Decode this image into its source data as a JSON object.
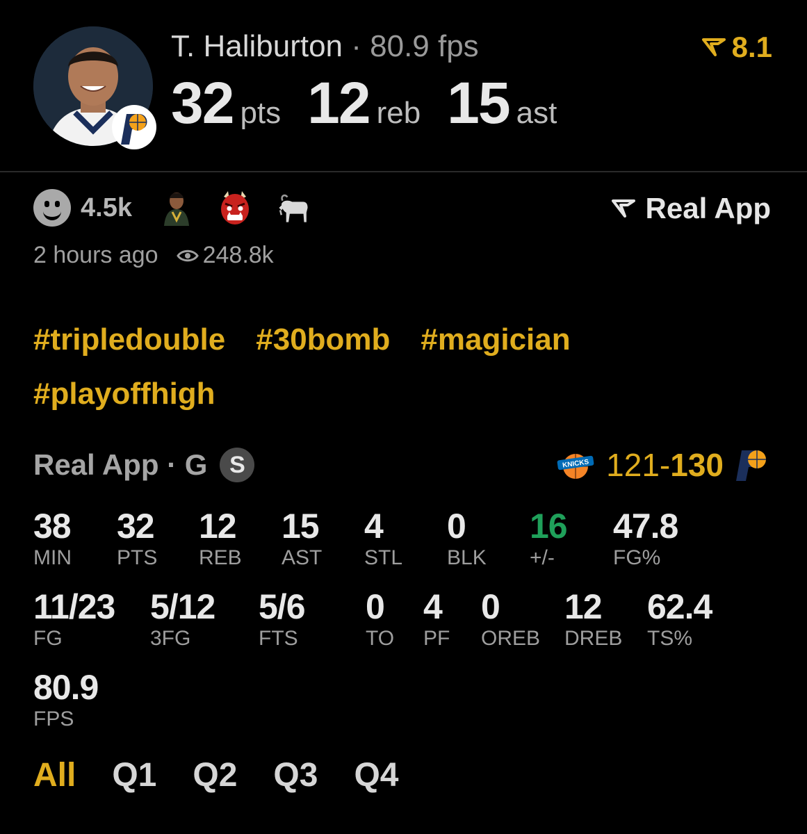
{
  "header": {
    "player_name": "T. Haliburton",
    "separator": " · ",
    "fps_text": "80.9 fps",
    "rating": "8.1",
    "big_stats": [
      {
        "value": "32",
        "unit": "pts"
      },
      {
        "value": "12",
        "unit": "reb"
      },
      {
        "value": "15",
        "unit": "ast"
      }
    ]
  },
  "reactions": {
    "count": "4.5k",
    "icons": [
      "smiley-icon",
      "player-emoji-icon",
      "oni-mask-icon",
      "goat-icon"
    ],
    "source_label": "Real App"
  },
  "meta": {
    "time": "2 hours ago",
    "views": "248.8k"
  },
  "hashtags": [
    "#tripledouble",
    "#30bomb",
    "#magician",
    "#playoffhigh"
  ],
  "box": {
    "source": "Real App",
    "position": "G",
    "badge": "S",
    "score_away": "121",
    "score_dash": "-",
    "score_home": "130",
    "away_team_icon": "knicks-logo",
    "home_team_icon": "pacers-logo",
    "row1": [
      {
        "value": "38",
        "label": "MIN"
      },
      {
        "value": "32",
        "label": "PTS"
      },
      {
        "value": "12",
        "label": "REB"
      },
      {
        "value": "15",
        "label": "AST"
      },
      {
        "value": "4",
        "label": "STL"
      },
      {
        "value": "0",
        "label": "BLK"
      },
      {
        "value": "16",
        "label": "+/-"
      },
      {
        "value": "47.8",
        "label": "FG%"
      }
    ],
    "row2": [
      {
        "value": "11/23",
        "label": "FG"
      },
      {
        "value": "5/12",
        "label": "3FG"
      },
      {
        "value": "5/6",
        "label": "FTS"
      },
      {
        "value": "0",
        "label": "TO"
      },
      {
        "value": "4",
        "label": "PF"
      },
      {
        "value": "0",
        "label": "OREB"
      },
      {
        "value": "12",
        "label": "DREB"
      },
      {
        "value": "62.4",
        "label": "TS%"
      }
    ],
    "row3": [
      {
        "value": "80.9",
        "label": "FPS"
      }
    ]
  },
  "tabs": [
    "All",
    "Q1",
    "Q2",
    "Q3",
    "Q4"
  ],
  "colors": {
    "accent": "#e0ad1e",
    "positive": "#1fa05a"
  }
}
